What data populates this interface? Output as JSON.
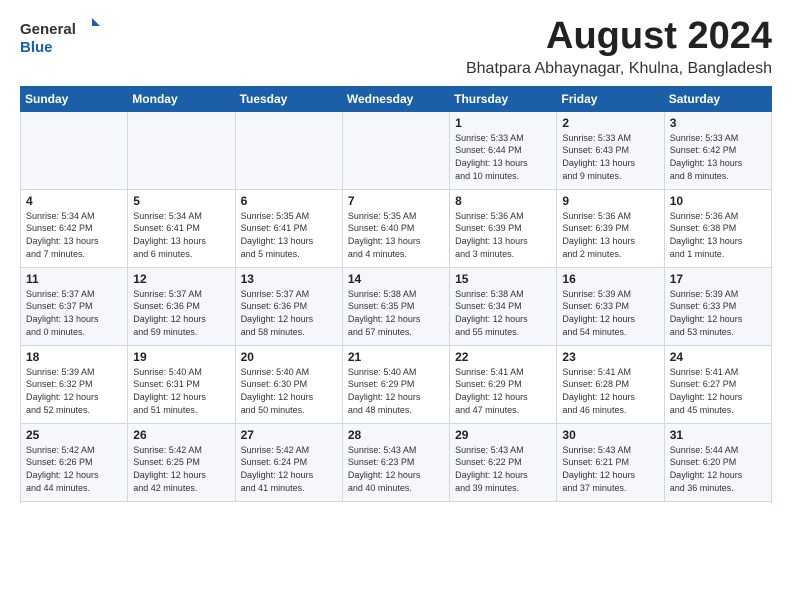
{
  "logo": {
    "text1": "General",
    "text2": "Blue"
  },
  "title": "August 2024",
  "location": "Bhatpara Abhaynagar, Khulna, Bangladesh",
  "days_of_week": [
    "Sunday",
    "Monday",
    "Tuesday",
    "Wednesday",
    "Thursday",
    "Friday",
    "Saturday"
  ],
  "weeks": [
    [
      {
        "day": "",
        "info": ""
      },
      {
        "day": "",
        "info": ""
      },
      {
        "day": "",
        "info": ""
      },
      {
        "day": "",
        "info": ""
      },
      {
        "day": "1",
        "info": "Sunrise: 5:33 AM\nSunset: 6:44 PM\nDaylight: 13 hours\nand 10 minutes."
      },
      {
        "day": "2",
        "info": "Sunrise: 5:33 AM\nSunset: 6:43 PM\nDaylight: 13 hours\nand 9 minutes."
      },
      {
        "day": "3",
        "info": "Sunrise: 5:33 AM\nSunset: 6:42 PM\nDaylight: 13 hours\nand 8 minutes."
      }
    ],
    [
      {
        "day": "4",
        "info": "Sunrise: 5:34 AM\nSunset: 6:42 PM\nDaylight: 13 hours\nand 7 minutes."
      },
      {
        "day": "5",
        "info": "Sunrise: 5:34 AM\nSunset: 6:41 PM\nDaylight: 13 hours\nand 6 minutes."
      },
      {
        "day": "6",
        "info": "Sunrise: 5:35 AM\nSunset: 6:41 PM\nDaylight: 13 hours\nand 5 minutes."
      },
      {
        "day": "7",
        "info": "Sunrise: 5:35 AM\nSunset: 6:40 PM\nDaylight: 13 hours\nand 4 minutes."
      },
      {
        "day": "8",
        "info": "Sunrise: 5:36 AM\nSunset: 6:39 PM\nDaylight: 13 hours\nand 3 minutes."
      },
      {
        "day": "9",
        "info": "Sunrise: 5:36 AM\nSunset: 6:39 PM\nDaylight: 13 hours\nand 2 minutes."
      },
      {
        "day": "10",
        "info": "Sunrise: 5:36 AM\nSunset: 6:38 PM\nDaylight: 13 hours\nand 1 minute."
      }
    ],
    [
      {
        "day": "11",
        "info": "Sunrise: 5:37 AM\nSunset: 6:37 PM\nDaylight: 13 hours\nand 0 minutes."
      },
      {
        "day": "12",
        "info": "Sunrise: 5:37 AM\nSunset: 6:36 PM\nDaylight: 12 hours\nand 59 minutes."
      },
      {
        "day": "13",
        "info": "Sunrise: 5:37 AM\nSunset: 6:36 PM\nDaylight: 12 hours\nand 58 minutes."
      },
      {
        "day": "14",
        "info": "Sunrise: 5:38 AM\nSunset: 6:35 PM\nDaylight: 12 hours\nand 57 minutes."
      },
      {
        "day": "15",
        "info": "Sunrise: 5:38 AM\nSunset: 6:34 PM\nDaylight: 12 hours\nand 55 minutes."
      },
      {
        "day": "16",
        "info": "Sunrise: 5:39 AM\nSunset: 6:33 PM\nDaylight: 12 hours\nand 54 minutes."
      },
      {
        "day": "17",
        "info": "Sunrise: 5:39 AM\nSunset: 6:33 PM\nDaylight: 12 hours\nand 53 minutes."
      }
    ],
    [
      {
        "day": "18",
        "info": "Sunrise: 5:39 AM\nSunset: 6:32 PM\nDaylight: 12 hours\nand 52 minutes."
      },
      {
        "day": "19",
        "info": "Sunrise: 5:40 AM\nSunset: 6:31 PM\nDaylight: 12 hours\nand 51 minutes."
      },
      {
        "day": "20",
        "info": "Sunrise: 5:40 AM\nSunset: 6:30 PM\nDaylight: 12 hours\nand 50 minutes."
      },
      {
        "day": "21",
        "info": "Sunrise: 5:40 AM\nSunset: 6:29 PM\nDaylight: 12 hours\nand 48 minutes."
      },
      {
        "day": "22",
        "info": "Sunrise: 5:41 AM\nSunset: 6:29 PM\nDaylight: 12 hours\nand 47 minutes."
      },
      {
        "day": "23",
        "info": "Sunrise: 5:41 AM\nSunset: 6:28 PM\nDaylight: 12 hours\nand 46 minutes."
      },
      {
        "day": "24",
        "info": "Sunrise: 5:41 AM\nSunset: 6:27 PM\nDaylight: 12 hours\nand 45 minutes."
      }
    ],
    [
      {
        "day": "25",
        "info": "Sunrise: 5:42 AM\nSunset: 6:26 PM\nDaylight: 12 hours\nand 44 minutes."
      },
      {
        "day": "26",
        "info": "Sunrise: 5:42 AM\nSunset: 6:25 PM\nDaylight: 12 hours\nand 42 minutes."
      },
      {
        "day": "27",
        "info": "Sunrise: 5:42 AM\nSunset: 6:24 PM\nDaylight: 12 hours\nand 41 minutes."
      },
      {
        "day": "28",
        "info": "Sunrise: 5:43 AM\nSunset: 6:23 PM\nDaylight: 12 hours\nand 40 minutes."
      },
      {
        "day": "29",
        "info": "Sunrise: 5:43 AM\nSunset: 6:22 PM\nDaylight: 12 hours\nand 39 minutes."
      },
      {
        "day": "30",
        "info": "Sunrise: 5:43 AM\nSunset: 6:21 PM\nDaylight: 12 hours\nand 37 minutes."
      },
      {
        "day": "31",
        "info": "Sunrise: 5:44 AM\nSunset: 6:20 PM\nDaylight: 12 hours\nand 36 minutes."
      }
    ]
  ]
}
